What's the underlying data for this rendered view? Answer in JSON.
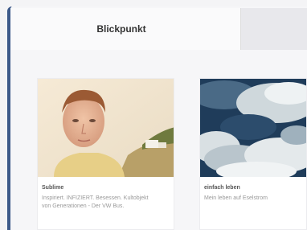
{
  "tabs": {
    "active_label": "Blickpunkt",
    "inactive_label": ""
  },
  "cards": [
    {
      "title": "Sublime",
      "text": "Inspiriert. INFIZIERT. Besessen. Kultobjekt von Generationen - Der VW Bus."
    },
    {
      "title": "einfach leben",
      "text": "Mein leben auf Eselstrom"
    }
  ],
  "colors": {
    "accent": "#3d5a8a",
    "tab_active_bg": "#fafafb",
    "tab_inactive_bg": "#e8e8ec"
  },
  "icons": {
    "card1_image": "portrait-photo",
    "card2_image": "cloudy-sky-photo"
  }
}
